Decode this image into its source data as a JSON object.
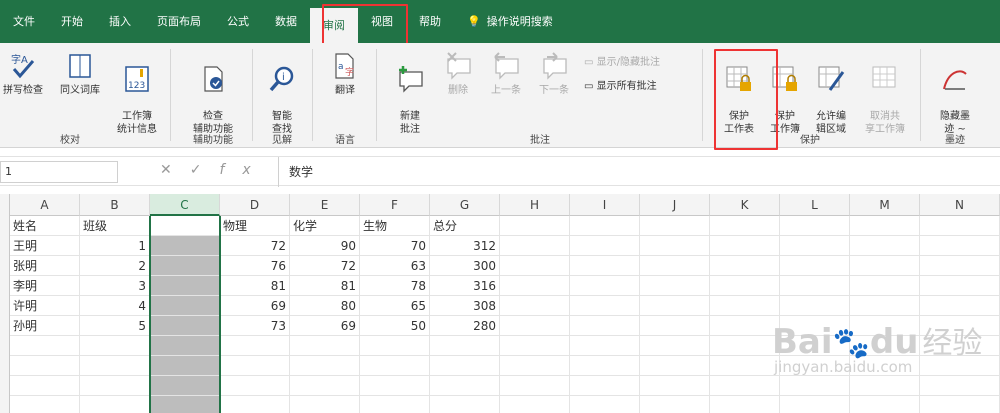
{
  "tabs": [
    "文件",
    "开始",
    "插入",
    "页面布局",
    "公式",
    "数据",
    "审阅",
    "视图",
    "帮助",
    "操作说明搜索"
  ],
  "active_tab": "审阅",
  "ribbon": {
    "proofing": {
      "spell": "拼写检查",
      "thesaurus": "同义词库",
      "stats": "工作簿\n统计信息",
      "label": "校对"
    },
    "accessibility": {
      "check": "检查\n辅助功能",
      "label": "辅助功能"
    },
    "insights": {
      "smart": "智能\n查找",
      "label": "见解"
    },
    "language": {
      "translate": "翻译",
      "label": "语言"
    },
    "comments": {
      "new": "新建\n批注",
      "delete": "删除",
      "prev": "上一条",
      "next": "下一条",
      "show_hide": "显示/隐藏批注",
      "show_all": "显示所有批注",
      "label": "批注"
    },
    "protect": {
      "sheet": "保护\n工作表",
      "workbook": "保护\n工作簿",
      "ranges": "允许编\n辑区域",
      "unshare": "取消共\n享工作簿",
      "label": "保护"
    },
    "ink": {
      "hide": "隐藏墨\n迹 ~",
      "label": "墨迹"
    }
  },
  "formula_bar": {
    "name_box": "1",
    "value": "数学"
  },
  "columns": [
    "A",
    "B",
    "C",
    "D",
    "E",
    "F",
    "G",
    "H",
    "I",
    "J",
    "K",
    "L",
    "M",
    "N"
  ],
  "headers": [
    "姓名",
    "班级",
    "",
    "物理",
    "化学",
    "生物",
    "总分"
  ],
  "rows": [
    [
      "王明",
      "1",
      "",
      "72",
      "90",
      "70",
      "312"
    ],
    [
      "张明",
      "2",
      "",
      "76",
      "72",
      "63",
      "300"
    ],
    [
      "李明",
      "3",
      "",
      "81",
      "81",
      "78",
      "316"
    ],
    [
      "许明",
      "4",
      "",
      "69",
      "80",
      "65",
      "308"
    ],
    [
      "孙明",
      "5",
      "",
      "73",
      "69",
      "50",
      "280"
    ]
  ],
  "watermark": {
    "brand": "Bai",
    "brand2": "du",
    "cn": "经验",
    "url": "jingyan.baidu.com"
  }
}
